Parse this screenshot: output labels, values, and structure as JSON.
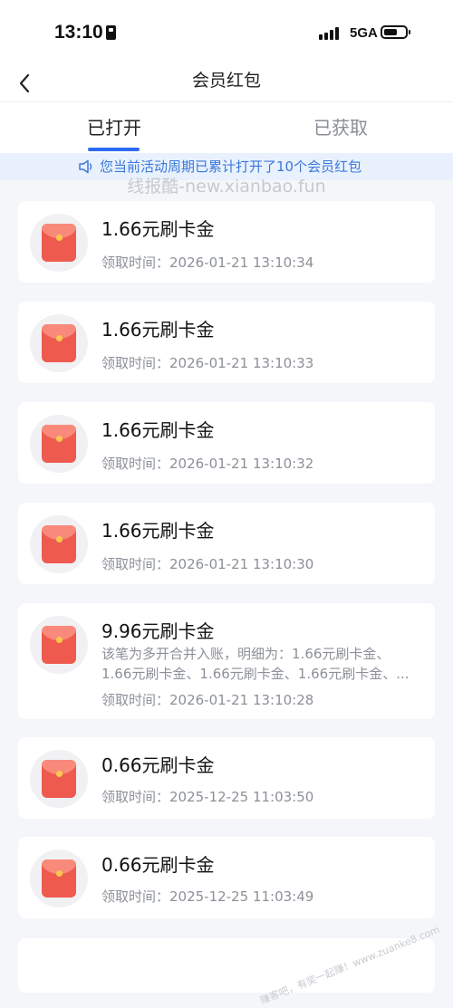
{
  "status": {
    "time": "13:10",
    "network": "5GA"
  },
  "nav": {
    "title": "会员红包"
  },
  "tabs": [
    {
      "label": "已打开"
    },
    {
      "label": "已获取"
    }
  ],
  "notice": {
    "text": "您当前活动周期已累计打开了10个会员红包"
  },
  "watermark": "线报酷-new.xianbao.fun",
  "records": [
    {
      "amount": "1.66元刷卡金",
      "time": "领取时间：2026-01-21 13:10:34"
    },
    {
      "amount": "1.66元刷卡金",
      "time": "领取时间：2026-01-21 13:10:33"
    },
    {
      "amount": "1.66元刷卡金",
      "time": "领取时间：2026-01-21 13:10:32"
    },
    {
      "amount": "1.66元刷卡金",
      "time": "领取时间：2026-01-21 13:10:30"
    },
    {
      "amount": "9.96元刷卡金",
      "detail1": "该笔为多开合并入账，明细为：1.66元刷卡金、",
      "detail2": "1.66元刷卡金、1.66元刷卡金、1.66元刷卡金、...",
      "time": "领取时间：2026-01-21 13:10:28"
    },
    {
      "amount": "0.66元刷卡金",
      "time": "领取时间：2025-12-25 11:03:50"
    },
    {
      "amount": "0.66元刷卡金",
      "time": "领取时间：2025-12-25 11:03:49"
    }
  ],
  "corner_watermark": "赚客吧，有奖一起赚！www.zuanke8.com",
  "colors": {
    "accent": "#2d6cf2",
    "envelope": "#ef5a4f",
    "notice_bg": "#e8f1fd"
  }
}
